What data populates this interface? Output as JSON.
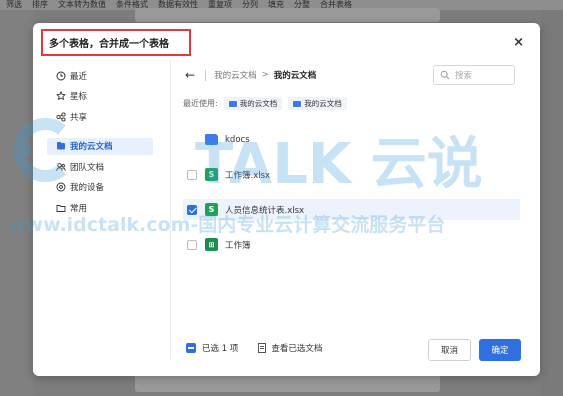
{
  "background": {
    "toolbar_items": [
      "筛选",
      "排序",
      "文本转为数值",
      "条件格式",
      "数据有效性",
      "重复项",
      "分列",
      "填充",
      "分整",
      "合并表格"
    ]
  },
  "dialog": {
    "title": "多个表格，合并成一个表格",
    "close_symbol": "×",
    "sidebar": {
      "items": [
        {
          "label": "最近",
          "icon": "clock-icon"
        },
        {
          "label": "星标",
          "icon": "star-icon"
        },
        {
          "label": "共享",
          "icon": "share-icon"
        },
        {
          "label": "我的云文档",
          "icon": "cloud-doc-icon",
          "active": true
        },
        {
          "label": "团队文档",
          "icon": "team-icon"
        },
        {
          "label": "我的设备",
          "icon": "device-icon"
        },
        {
          "label": "常用",
          "icon": "folder-icon"
        }
      ]
    },
    "nav": {
      "back_symbol": "←",
      "crumb_parent": "我的云文档",
      "crumb_separator": ">",
      "crumb_current": "我的云文档",
      "search_placeholder": "搜索"
    },
    "recent": {
      "label": "最近使用:",
      "chips": [
        "我的云文档",
        "我的云文档"
      ]
    },
    "files": [
      {
        "name": "kdocs",
        "type": "folder",
        "checked": false,
        "selected": false
      },
      {
        "name": "工作簿.xlsx",
        "type": "sheet",
        "checked": false,
        "selected": false
      },
      {
        "name": "人员信息统计表.xlsx",
        "type": "sheet",
        "checked": true,
        "selected": true
      },
      {
        "name": "工作簿",
        "type": "table",
        "checked": false,
        "selected": false
      }
    ],
    "footer": {
      "selected_text": "已选 1 项",
      "view_selected_text": "查看已选文档",
      "cancel_label": "取消",
      "ok_label": "确定"
    }
  },
  "watermark": {
    "brand": "TALK 云说",
    "url_text": "www.idctalk.com-国内专业云计算交流服务平台",
    "color": "#3a9ad9"
  },
  "colors": {
    "accent": "#2f6fe0",
    "title_outline": "#e4393c",
    "sheet_green": "#1fa15a"
  }
}
